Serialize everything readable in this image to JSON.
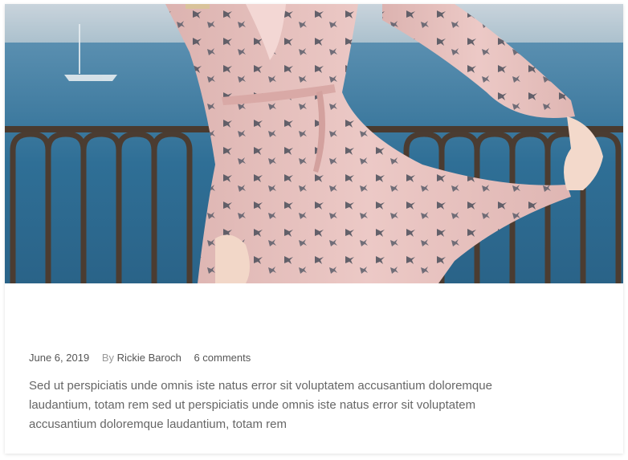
{
  "post": {
    "image_alt": "Woman in pink bird-print wrap dress by the sea railing",
    "date": "June 6, 2019",
    "by_label": "By",
    "author": "Rickie Baroch",
    "comments": "6 comments",
    "excerpt": "Sed ut perspiciatis unde omnis iste natus error sit voluptatem accusantium doloremque laudantium, totam rem sed ut perspiciatis unde omnis iste natus error sit voluptatem accusantium doloremque laudantium, totam rem"
  },
  "colors": {
    "sky": "#b9c9d4",
    "sea": "#2f6f96",
    "dress": "#e8c2bf",
    "railing": "#4a3b30",
    "text_muted": "#666666"
  }
}
